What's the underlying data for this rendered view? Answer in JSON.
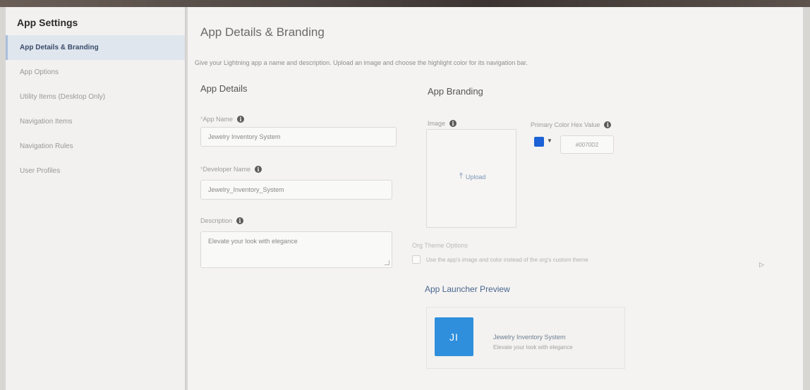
{
  "window": {
    "help_glyph": "?"
  },
  "sidebar": {
    "title": "App Settings",
    "items": [
      {
        "label": "App Details & Branding",
        "active": true
      },
      {
        "label": "App Options",
        "active": false
      },
      {
        "label": "Utility Items (Desktop Only)",
        "active": false
      },
      {
        "label": "Navigation Items",
        "active": false
      },
      {
        "label": "Navigation Rules",
        "active": false
      },
      {
        "label": "User Profiles",
        "active": false
      }
    ]
  },
  "main": {
    "title": "App Details & Branding",
    "subtitle": "Give your Lightning app a name and description. Upload an image and choose the highlight color for its navigation bar.",
    "details": {
      "heading": "App Details",
      "app_name": {
        "label": "App Name",
        "required_mark": "*",
        "value": "Jewelry Inventory System"
      },
      "developer_name": {
        "label": "Developer Name",
        "required_mark": "*",
        "value": "Jewelry_Inventory_System"
      },
      "description": {
        "label": "Description",
        "value": "Elevate your look with elegance"
      }
    },
    "branding": {
      "heading": "App Branding",
      "image_label": "Image",
      "upload_label": "Upload",
      "upload_icon": "upload-arrow",
      "primary_color_label": "Primary Color Hex Value",
      "primary_color_hex": "#0070D2",
      "swatch_color": "#1c62d6",
      "org_theme_label": "Org Theme Options",
      "org_theme_checkbox_label": "Use the app's image and color instead of the org's custom theme",
      "org_theme_checked": false
    },
    "preview": {
      "heading": "App Launcher Preview",
      "initials": "JI",
      "tile_color": "#2f8fdc",
      "app_name": "Jewelry Inventory System",
      "description": "Elevate your look with elegance"
    }
  }
}
